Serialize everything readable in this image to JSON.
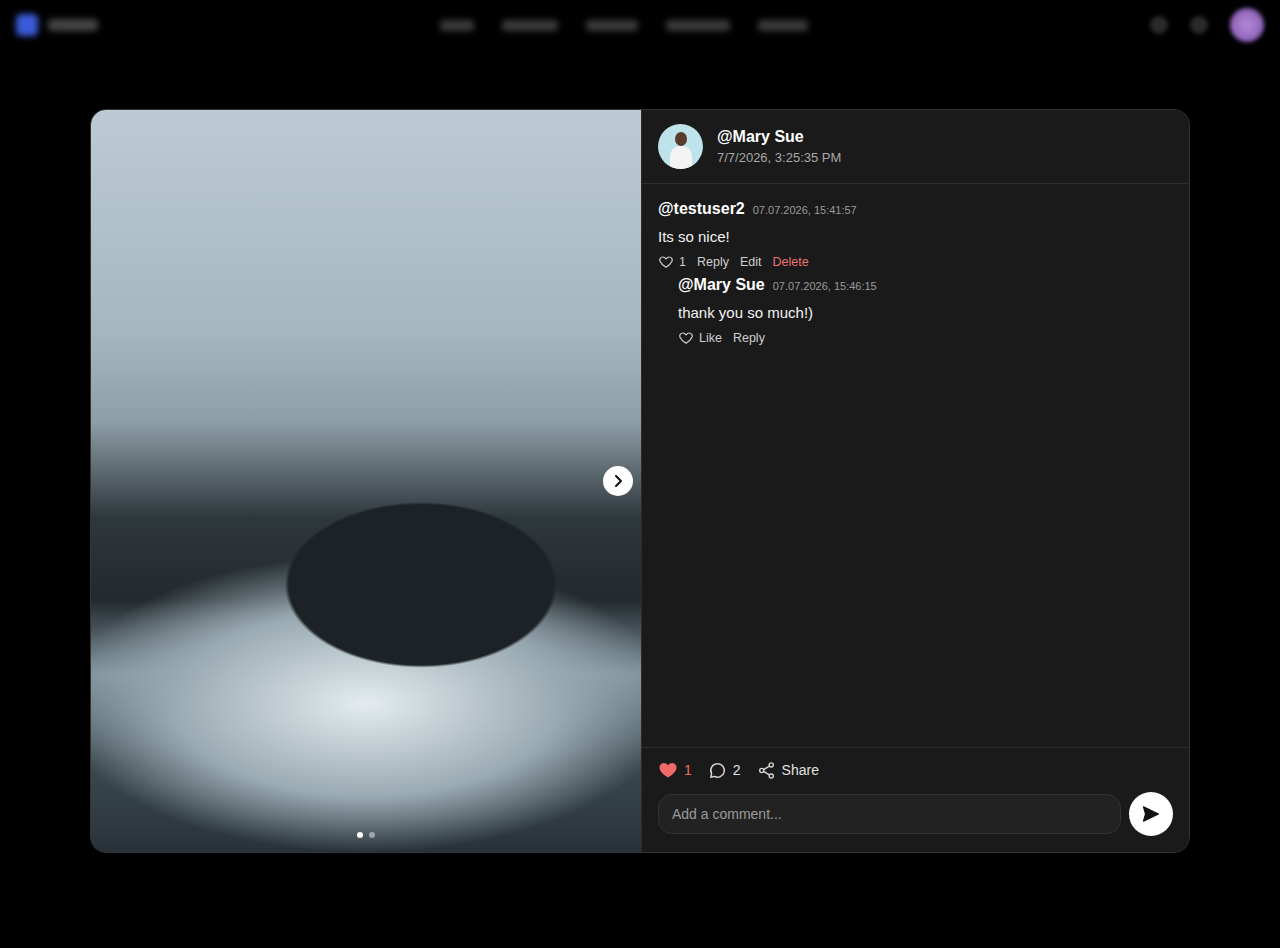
{
  "post": {
    "author": "@Mary Sue",
    "timestamp": "7/7/2026, 3:25:35 PM"
  },
  "gallery": {
    "slides": [
      {
        "selected": true
      },
      {
        "selected": false
      }
    ]
  },
  "comments": [
    {
      "author": "@testuser2",
      "time": "07.07.2026, 15:41:57",
      "text": "Its so nice!",
      "likes": "1",
      "liked": false,
      "actions": [
        {
          "label": "Reply",
          "kind": "normal"
        },
        {
          "label": "Edit",
          "kind": "normal"
        },
        {
          "label": "Delete",
          "kind": "danger"
        }
      ],
      "replies": [
        {
          "author": "@Mary Sue",
          "time": "07.07.2026, 15:46:15",
          "text": "thank you so much!)",
          "like_label": "Like",
          "liked": false,
          "actions": [
            {
              "label": "Reply",
              "kind": "normal"
            }
          ]
        }
      ]
    }
  ],
  "footer": {
    "likes": "1",
    "liked": true,
    "comments": "2",
    "share": "Share"
  },
  "composer": {
    "placeholder": "Add a comment..."
  }
}
